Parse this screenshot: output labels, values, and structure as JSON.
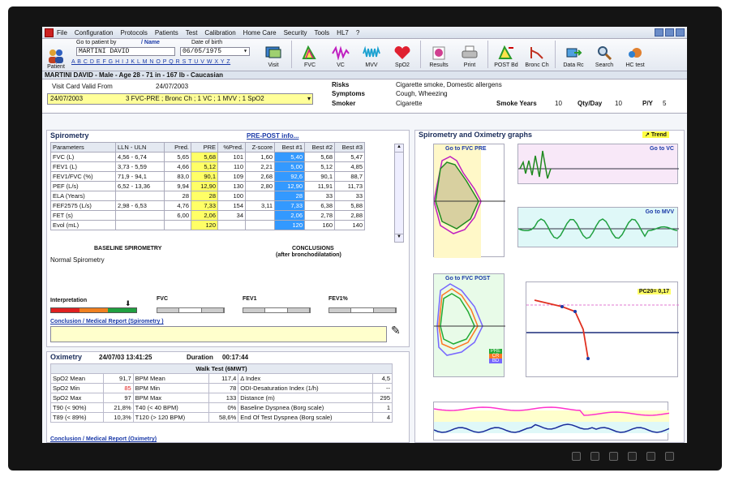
{
  "menu": [
    "File",
    "Configuration",
    "Protocols",
    "Patients",
    "Test",
    "Calibration",
    "Home Care",
    "Security",
    "Tools",
    "HL7",
    "?"
  ],
  "toolbar": {
    "patient_label": "Patient",
    "goto_label": "Go to patient by",
    "by_name": "/ Name",
    "dob_label": "Date of birth",
    "patient_name": "MARTINI DAVID",
    "dob_value": "06/05/1975",
    "alphabet": "A B C D E F G H I J K L M N O P Q R S T U V W X Y Z",
    "buttons": [
      "Visit",
      "FVC",
      "VC",
      "MVV",
      "SpO2",
      "Results",
      "Print",
      "POST Bd",
      "Bronc Ch",
      "Data Rc",
      "Search",
      "HC test"
    ]
  },
  "patient_bar": "MARTINI DAVID - Male - Age 28 - 71 in - 167 lb - Caucasian",
  "visit": {
    "label": "Visit Card Valid From",
    "from": "24/07/2003",
    "date": "24/07/2003",
    "tests": "3 FVC-PRE ; Bronc Ch ; 1 VC ; 1 MVV ; 1 SpO2"
  },
  "risk": {
    "risks_label": "Risks",
    "risks": "Cigarette smoke, Domestic allergens",
    "symptoms_label": "Symptoms",
    "symptoms": "Cough, Wheezing",
    "smoker_label": "Smoker",
    "smoker": "Cigarette",
    "smoke_years_label": "Smoke Years",
    "smoke_years": "10",
    "qty_label": "Qty/Day",
    "qty": "10",
    "py_label": "P/Y",
    "py": "5"
  },
  "spirometry": {
    "title": "Spirometry",
    "prepost": "PRE-POST info...",
    "headers": [
      "Parameters",
      "LLN - ULN",
      "Pred.",
      "PRE",
      "%Pred.",
      "Z-score",
      "Best #1",
      "Best #2",
      "Best #3"
    ],
    "rows": [
      [
        "FVC (L)",
        "4,56 - 6,74",
        "5,65",
        "5,68",
        "101",
        "1,60",
        "5,40",
        "5,68",
        "5,47"
      ],
      [
        "FEV1 (L)",
        "3,73 - 5,59",
        "4,66",
        "5,12",
        "110",
        "2,21",
        "5,00",
        "5,12",
        "4,85"
      ],
      [
        "FEV1/FVC (%)",
        "71,9 - 94,1",
        "83,0",
        "90,1",
        "109",
        "2,68",
        "92,6",
        "90,1",
        "88,7"
      ],
      [
        "PEF (L/s)",
        "6,52 - 13,36",
        "9,94",
        "12,90",
        "130",
        "2,80",
        "12,90",
        "11,91",
        "11,73"
      ],
      [
        "ELA (Years)",
        "",
        "28",
        "28",
        "100",
        "",
        "28",
        "33",
        "33"
      ],
      [
        "FEF2575 (L/s)",
        "2,98 - 6,53",
        "4,76",
        "7,33",
        "154",
        "3,11",
        "7,33",
        "6,38",
        "5,88"
      ],
      [
        "FET (s)",
        "",
        "6,00",
        "2,06",
        "34",
        "",
        "2,06",
        "2,78",
        "2,88"
      ],
      [
        "Evol (mL)",
        "",
        "",
        "120",
        "",
        "",
        "120",
        "160",
        "140"
      ]
    ],
    "baseline_label": "BASELINE SPIROMETRY",
    "baseline_text": "Normal Spirometry",
    "conclusions_label": "CONCLUSIONS",
    "conclusions_sub": "(after bronchodilatation)",
    "interpretation_label": "Interpretation",
    "fvc": "FVC",
    "fev1": "FEV1",
    "fevpct": "FEV1%",
    "conclusion_report": "Conclusion / Medical Report (Spirometry )"
  },
  "oximetry": {
    "title": "Oximetry",
    "date": "24/07/03 13:41:25",
    "duration_label": "Duration",
    "duration": "00:17:44",
    "walk_test": "Walk Test (6MWT)",
    "rows": [
      [
        "SpO2 Mean",
        "91,7",
        "BPM Mean",
        "117,4",
        "Δ Index",
        "4,5"
      ],
      [
        "SpO2 Min",
        "85",
        "BPM Min",
        "78",
        "ODI-Desaturation Index (1/h)",
        "--"
      ],
      [
        "SpO2 Max",
        "97",
        "BPM Max",
        "133",
        "Distance (m)",
        "295"
      ],
      [
        "T90 (< 90%)",
        "21,8%",
        "T40 (< 40 BPM)",
        "0%",
        "Baseline Dyspnea (Borg scale)",
        "1"
      ],
      [
        "T89 (< 89%)",
        "10,3%",
        "T120 (> 120 BPM)",
        "58,6%",
        "End Of Test Dyspnea (Borg scale)",
        "4"
      ]
    ],
    "conclusion_report": "Conclusion / Medical Report (Oximetry)"
  },
  "graphs": {
    "title": "Spirometry and Oximetry graphs",
    "trend": "Trend",
    "fvc_pre": "Go to FVC PRE",
    "vc": "Go to VC",
    "mvv": "Go to MVV",
    "fvc_post": "Go to FVC POST",
    "pc20": "PC20= 0,17",
    "legend": [
      "PRE",
      "CR",
      "BD"
    ]
  },
  "colors": {
    "highlight_yellow": "#ffff66",
    "best_blue": "#3399ff",
    "pre_green": "#22aa33",
    "cr_orange": "#ff7722",
    "bd_purple": "#7766ff"
  }
}
